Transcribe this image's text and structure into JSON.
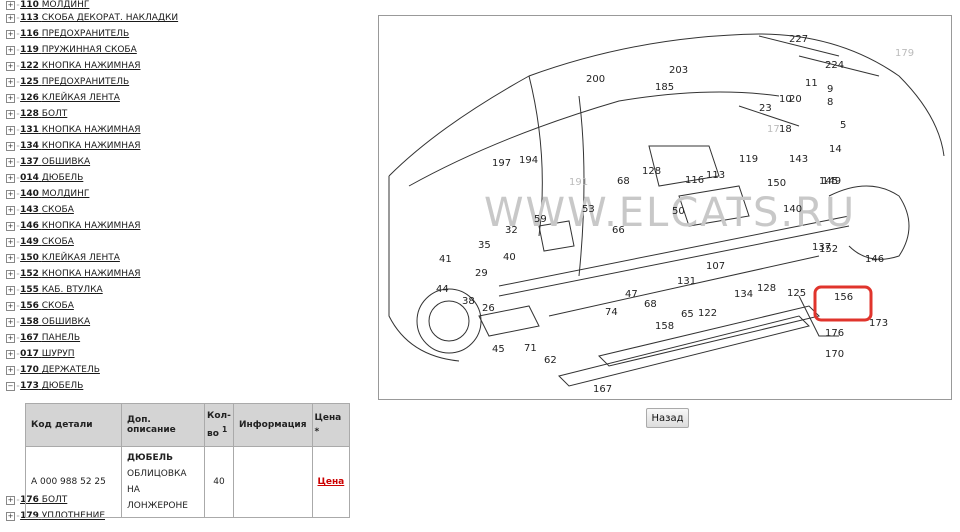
{
  "parts": [
    {
      "code": "110",
      "name": "МОЛДИНГ"
    },
    {
      "code": "113",
      "name": "СКОБА ДЕКОРАТ. НАКЛАДКИ"
    },
    {
      "code": "116",
      "name": "ПРЕДОХРАНИТЕЛЬ"
    },
    {
      "code": "119",
      "name": "ПРУЖИННАЯ СКОБА"
    },
    {
      "code": "122",
      "name": "КНОПКА НАЖИМНАЯ"
    },
    {
      "code": "125",
      "name": "ПРЕДОХРАНИТЕЛЬ"
    },
    {
      "code": "126",
      "name": "КЛЕЙКАЯ ЛЕНТА"
    },
    {
      "code": "128",
      "name": "БОЛТ"
    },
    {
      "code": "131",
      "name": "КНОПКА НАЖИМНАЯ"
    },
    {
      "code": "134",
      "name": "КНОПКА НАЖИМНАЯ"
    },
    {
      "code": "137",
      "name": "ОБШИВКА"
    },
    {
      "code": "014",
      "name": "ДЮБЕЛЬ"
    },
    {
      "code": "140",
      "name": "МОЛДИНГ"
    },
    {
      "code": "143",
      "name": "СКОБА"
    },
    {
      "code": "146",
      "name": "КНОПКА НАЖИМНАЯ"
    },
    {
      "code": "149",
      "name": "СКОБА"
    },
    {
      "code": "150",
      "name": "КЛЕЙКАЯ ЛЕНТА"
    },
    {
      "code": "152",
      "name": "КНОПКА НАЖИМНАЯ"
    },
    {
      "code": "155",
      "name": "КАБ. ВТУЛКА"
    },
    {
      "code": "156",
      "name": "СКОБА"
    },
    {
      "code": "158",
      "name": "ОБШИВКА"
    },
    {
      "code": "167",
      "name": "ПАНЕЛЬ"
    },
    {
      "code": "017",
      "name": "ШУРУП"
    },
    {
      "code": "170",
      "name": "ДЕРЖАТЕЛЬ"
    },
    {
      "code": "173",
      "name": "ДЮБЕЛЬ"
    }
  ],
  "parts_after": [
    {
      "code": "176",
      "name": "БОЛТ"
    },
    {
      "code": "179",
      "name": "УПЛОТНЕНИЕ"
    }
  ],
  "table": {
    "headers": {
      "code": "Код детали",
      "extra": "Доп. описание",
      "qty_line1": "Кол-",
      "qty_line2": "во",
      "qty_sup": "1",
      "info": "Информация",
      "price_line1": "Цена",
      "price_line2": "*"
    },
    "row": {
      "code": "A  000 988 52 25",
      "desc_title": "ДЮБЕЛЬ",
      "desc_line1": "ОБЛИЦОВКА НА",
      "desc_line2": "ЛОНЖЕРОНЕ",
      "qty": "40",
      "info": "",
      "price": "Цена"
    }
  },
  "diagram": {
    "watermark": "WWW.ELCATS.RU",
    "highlight_color": "#e0342c",
    "callouts": [
      "227",
      "224",
      "200",
      "203",
      "185",
      "11",
      "10",
      "20",
      "9",
      "8",
      "23",
      "5",
      "17",
      "18",
      "14",
      "197",
      "194",
      "191",
      "128",
      "116",
      "113",
      "119",
      "150",
      "143",
      "140",
      "149",
      "145",
      "68",
      "53",
      "50",
      "59",
      "66",
      "32",
      "35",
      "40",
      "41",
      "29",
      "44",
      "38",
      "26",
      "45",
      "71",
      "62",
      "74",
      "47",
      "68",
      "131",
      "65",
      "122",
      "107",
      "134",
      "128",
      "125",
      "137",
      "152",
      "146",
      "156",
      "173",
      "176",
      "170",
      "167",
      "158",
      "179"
    ]
  },
  "back_label": "Назад",
  "colors": {
    "price_link": "#cc0000",
    "header_bg": "#d4d4d4"
  }
}
